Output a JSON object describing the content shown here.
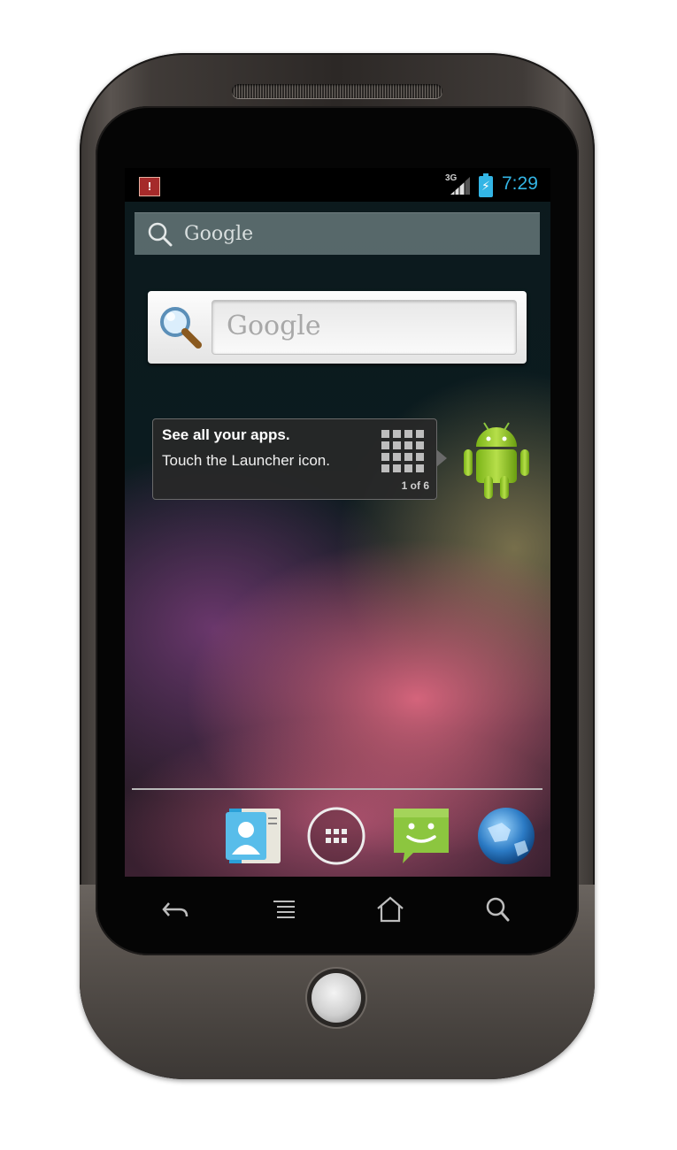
{
  "status_bar": {
    "network": "3G",
    "time": "7:29",
    "notification_icon": "alert-icon",
    "battery_icon": "battery-charging-icon"
  },
  "search_bar": {
    "label": "Google",
    "icon": "search-icon"
  },
  "google_widget": {
    "placeholder": "Google",
    "icon": "magnifier-icon"
  },
  "cling": {
    "title": "See all your apps.",
    "body": "Touch the Launcher icon.",
    "page": "1 of 6",
    "icon": "launcher-grid-icon",
    "mascot": "android-robot-icon"
  },
  "dock": {
    "apps": [
      {
        "name": "contacts",
        "icon": "contacts-icon"
      },
      {
        "name": "launcher",
        "icon": "all-apps-icon"
      },
      {
        "name": "messaging",
        "icon": "messaging-icon"
      },
      {
        "name": "browser",
        "icon": "globe-icon"
      }
    ]
  },
  "navigation": {
    "buttons": [
      "back-icon",
      "menu-icon",
      "home-icon",
      "search-icon"
    ]
  },
  "colors": {
    "accent": "#33b5e5",
    "phone_body": "#3a3633"
  }
}
